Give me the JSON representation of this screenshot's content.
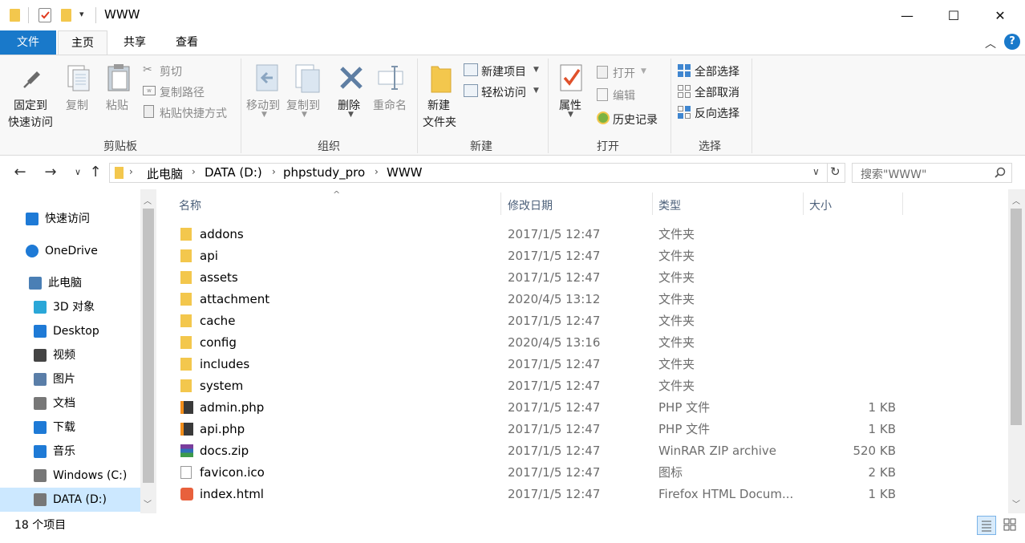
{
  "window": {
    "title": "WWW",
    "controls": {
      "minimize": "—",
      "maximize": "☐",
      "close": "✕"
    }
  },
  "tabs": [
    {
      "label": "文件"
    },
    {
      "label": "主页"
    },
    {
      "label": "共享"
    },
    {
      "label": "查看"
    }
  ],
  "ribbon": {
    "clipboard": {
      "pin_label_1": "固定到",
      "pin_label_2": "快速访问",
      "copy": "复制",
      "paste": "粘贴",
      "cut": "剪切",
      "copy_path": "复制路径",
      "paste_shortcut": "粘贴快捷方式",
      "group": "剪贴板"
    },
    "organize": {
      "move_to": "移动到",
      "copy_to": "复制到",
      "delete": "删除",
      "rename": "重命名",
      "group": "组织"
    },
    "new": {
      "new_folder_1": "新建",
      "new_folder_2": "文件夹",
      "new_item": "新建项目",
      "easy_access": "轻松访问",
      "group": "新建"
    },
    "open": {
      "properties": "属性",
      "open": "打开",
      "edit": "编辑",
      "history": "历史记录",
      "group": "打开"
    },
    "select": {
      "select_all": "全部选择",
      "select_none": "全部取消",
      "invert": "反向选择",
      "group": "选择"
    }
  },
  "address": {
    "crumbs": [
      "此电脑",
      "DATA (D:)",
      "phpstudy_pro",
      "WWW"
    ],
    "search_placeholder": "搜索\"WWW\""
  },
  "nav": [
    {
      "label": "快速访问",
      "icon": "star-icon",
      "color": "#1e7ad6"
    },
    {
      "label": "OneDrive",
      "icon": "cloud-icon",
      "color": "#1e7ad6"
    },
    {
      "label": "此电脑",
      "icon": "computer-icon",
      "color": "#4a7fb5"
    },
    {
      "label": "3D 对象",
      "icon": "cube-icon",
      "color": "#2aa7d8"
    },
    {
      "label": "Desktop",
      "icon": "desktop-icon",
      "color": "#1e7ad6"
    },
    {
      "label": "视频",
      "icon": "film-icon",
      "color": "#444"
    },
    {
      "label": "图片",
      "icon": "picture-icon",
      "color": "#5a7ea8"
    },
    {
      "label": "文档",
      "icon": "document-icon",
      "color": "#777"
    },
    {
      "label": "下载",
      "icon": "download-icon",
      "color": "#1e7ad6"
    },
    {
      "label": "音乐",
      "icon": "music-icon",
      "color": "#1e7ad6"
    },
    {
      "label": "Windows (C:)",
      "icon": "drive-icon",
      "color": "#777"
    },
    {
      "label": "DATA (D:)",
      "icon": "drive-icon",
      "color": "#777"
    }
  ],
  "columns": {
    "name": "名称",
    "date": "修改日期",
    "type": "类型",
    "size": "大小"
  },
  "files": [
    {
      "name": "addons",
      "date": "2017/1/5 12:47",
      "type": "文件夹",
      "size": "",
      "icon": "folder-icon"
    },
    {
      "name": "api",
      "date": "2017/1/5 12:47",
      "type": "文件夹",
      "size": "",
      "icon": "folder-icon"
    },
    {
      "name": "assets",
      "date": "2017/1/5 12:47",
      "type": "文件夹",
      "size": "",
      "icon": "folder-icon"
    },
    {
      "name": "attachment",
      "date": "2020/4/5 13:12",
      "type": "文件夹",
      "size": "",
      "icon": "folder-icon"
    },
    {
      "name": "cache",
      "date": "2017/1/5 12:47",
      "type": "文件夹",
      "size": "",
      "icon": "folder-icon"
    },
    {
      "name": "config",
      "date": "2020/4/5 13:16",
      "type": "文件夹",
      "size": "",
      "icon": "folder-icon"
    },
    {
      "name": "includes",
      "date": "2017/1/5 12:47",
      "type": "文件夹",
      "size": "",
      "icon": "folder-icon"
    },
    {
      "name": "system",
      "date": "2017/1/5 12:47",
      "type": "文件夹",
      "size": "",
      "icon": "folder-icon"
    },
    {
      "name": "admin.php",
      "date": "2017/1/5 12:47",
      "type": "PHP 文件",
      "size": "1 KB",
      "icon": "php-file-icon"
    },
    {
      "name": "api.php",
      "date": "2017/1/5 12:47",
      "type": "PHP 文件",
      "size": "1 KB",
      "icon": "php-file-icon"
    },
    {
      "name": "docs.zip",
      "date": "2017/1/5 12:47",
      "type": "WinRAR ZIP archive",
      "size": "520 KB",
      "icon": "zip-file-icon"
    },
    {
      "name": "favicon.ico",
      "date": "2017/1/5 12:47",
      "type": "图标",
      "size": "2 KB",
      "icon": "ico-file-icon"
    },
    {
      "name": "index.html",
      "date": "2017/1/5 12:47",
      "type": "Firefox HTML Docum...",
      "size": "1 KB",
      "icon": "html-file-icon"
    }
  ],
  "status": {
    "count": "18 个项目"
  },
  "colors": {
    "accent": "#1979ca",
    "selected_nav": "#cce8ff",
    "folder": "#f3c74d"
  }
}
